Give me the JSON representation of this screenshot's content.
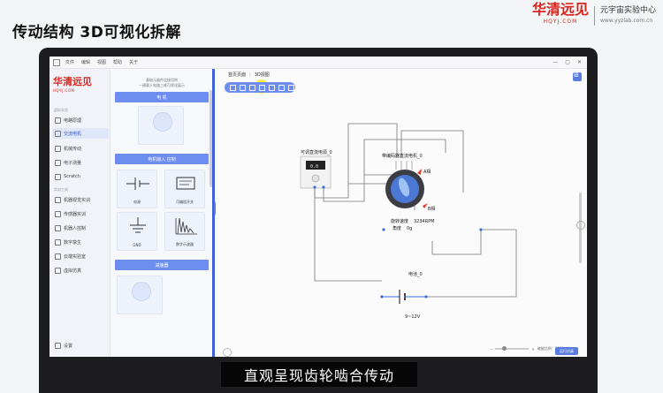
{
  "video": {
    "title": "传动结构 3D可视化拆解",
    "subtitle": "直观呈现齿轮啮合传动"
  },
  "brand": {
    "logo": "华清远见",
    "logo_sub": "HQYJ.COM",
    "lab_name": "元宇宙实验中心",
    "url": "www.yyzlab.com.cn"
  },
  "window": {
    "menus": [
      "文件",
      "编辑",
      "视图",
      "帮助",
      "关于"
    ],
    "controls": [
      "—",
      "▢",
      "✕"
    ]
  },
  "sidebar": {
    "logo": "华清远见",
    "logo_sub": "HQYJ.COM",
    "section1": "虚拟实验",
    "items1": [
      {
        "label": "电路原理",
        "active": false
      },
      {
        "label": "交流电机",
        "active": true
      },
      {
        "label": "机械传动",
        "active": false
      },
      {
        "label": "电子测量",
        "active": false
      },
      {
        "label": "Scratch",
        "active": false
      }
    ],
    "section2": "实训工具",
    "items2": [
      {
        "label": "机器视觉实训"
      },
      {
        "label": "传感器实训"
      },
      {
        "label": "机器人控制"
      },
      {
        "label": "数字孪生"
      },
      {
        "label": "云端实验室"
      },
      {
        "label": "虚拟仿真"
      }
    ],
    "settings": "设置"
  },
  "panel": {
    "head_line1": "基础元器件连接用例",
    "head_line2": "一键载入电路三维可视化展示",
    "cat1": "电 机",
    "cat2": "电机输入 控制",
    "cat3": "减速器",
    "cards": [
      {
        "label": "电源"
      },
      {
        "label": "可编程开关"
      },
      {
        "label": "GND"
      },
      {
        "label": "数字示波器"
      }
    ]
  },
  "canvas": {
    "breadcrumb1": "首页页面",
    "breadcrumb2": "3D视图",
    "zoom_text": "缩放比例：100%",
    "zoom_level": 0.25,
    "run_button": "运行仿真"
  },
  "diagram": {
    "psu_label": "可调直流电源_0",
    "psu_display": "0.0",
    "motor_label": "带编码器直流电机_0",
    "motor_a": "A相",
    "motor_b": "B相",
    "speed_label": "旋转速度",
    "speed_value": "3234RPM",
    "angle_label": "角度",
    "angle_value": "0g",
    "battery_label": "电池_0",
    "battery_voltage": "9~12V",
    "colors": {
      "wire": "#777777",
      "node": "#3b6fd6",
      "motor_blue": "#2c64c8",
      "arrow_red": "#e03a2a"
    }
  }
}
